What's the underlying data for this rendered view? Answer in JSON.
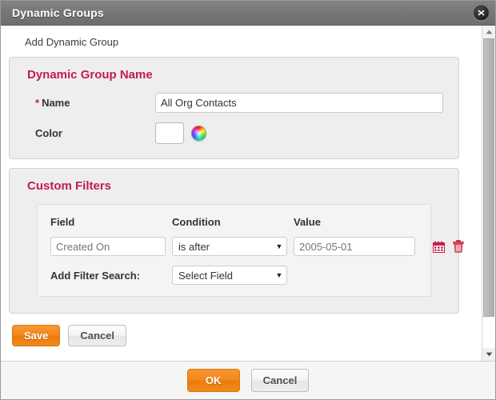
{
  "window": {
    "title": "Dynamic Groups",
    "close_icon": "close-icon"
  },
  "subtitle": "Add Dynamic Group",
  "group_name_panel": {
    "title": "Dynamic Group Name",
    "name_field": {
      "required_marker": "*",
      "label": "Name",
      "value": "All Org Contacts",
      "placeholder": ""
    },
    "color_field": {
      "label": "Color",
      "swatch_value": "#ffffff",
      "picker_icon": "color-wheel-icon"
    }
  },
  "custom_filters_panel": {
    "title": "Custom Filters",
    "columns": {
      "field": "Field",
      "condition": "Condition",
      "value": "Value"
    },
    "rows": [
      {
        "field_placeholder": "Created On",
        "field_value": "",
        "condition_selected": "is after",
        "value_placeholder": "2005-05-01",
        "value_value": "",
        "calendar_icon": "calendar-icon",
        "delete_icon": "trash-icon"
      }
    ],
    "add_filter": {
      "label": "Add Filter Search:",
      "select_value": "Select Field"
    }
  },
  "form_actions": {
    "save_label": "Save",
    "cancel_label": "Cancel"
  },
  "footer_actions": {
    "ok_label": "OK",
    "cancel_label": "Cancel"
  },
  "colors": {
    "titlebar": "#767676",
    "heading_accent": "#c41c4e",
    "primary_button": "#ef8a1d",
    "required_marker": "#cc2222"
  }
}
